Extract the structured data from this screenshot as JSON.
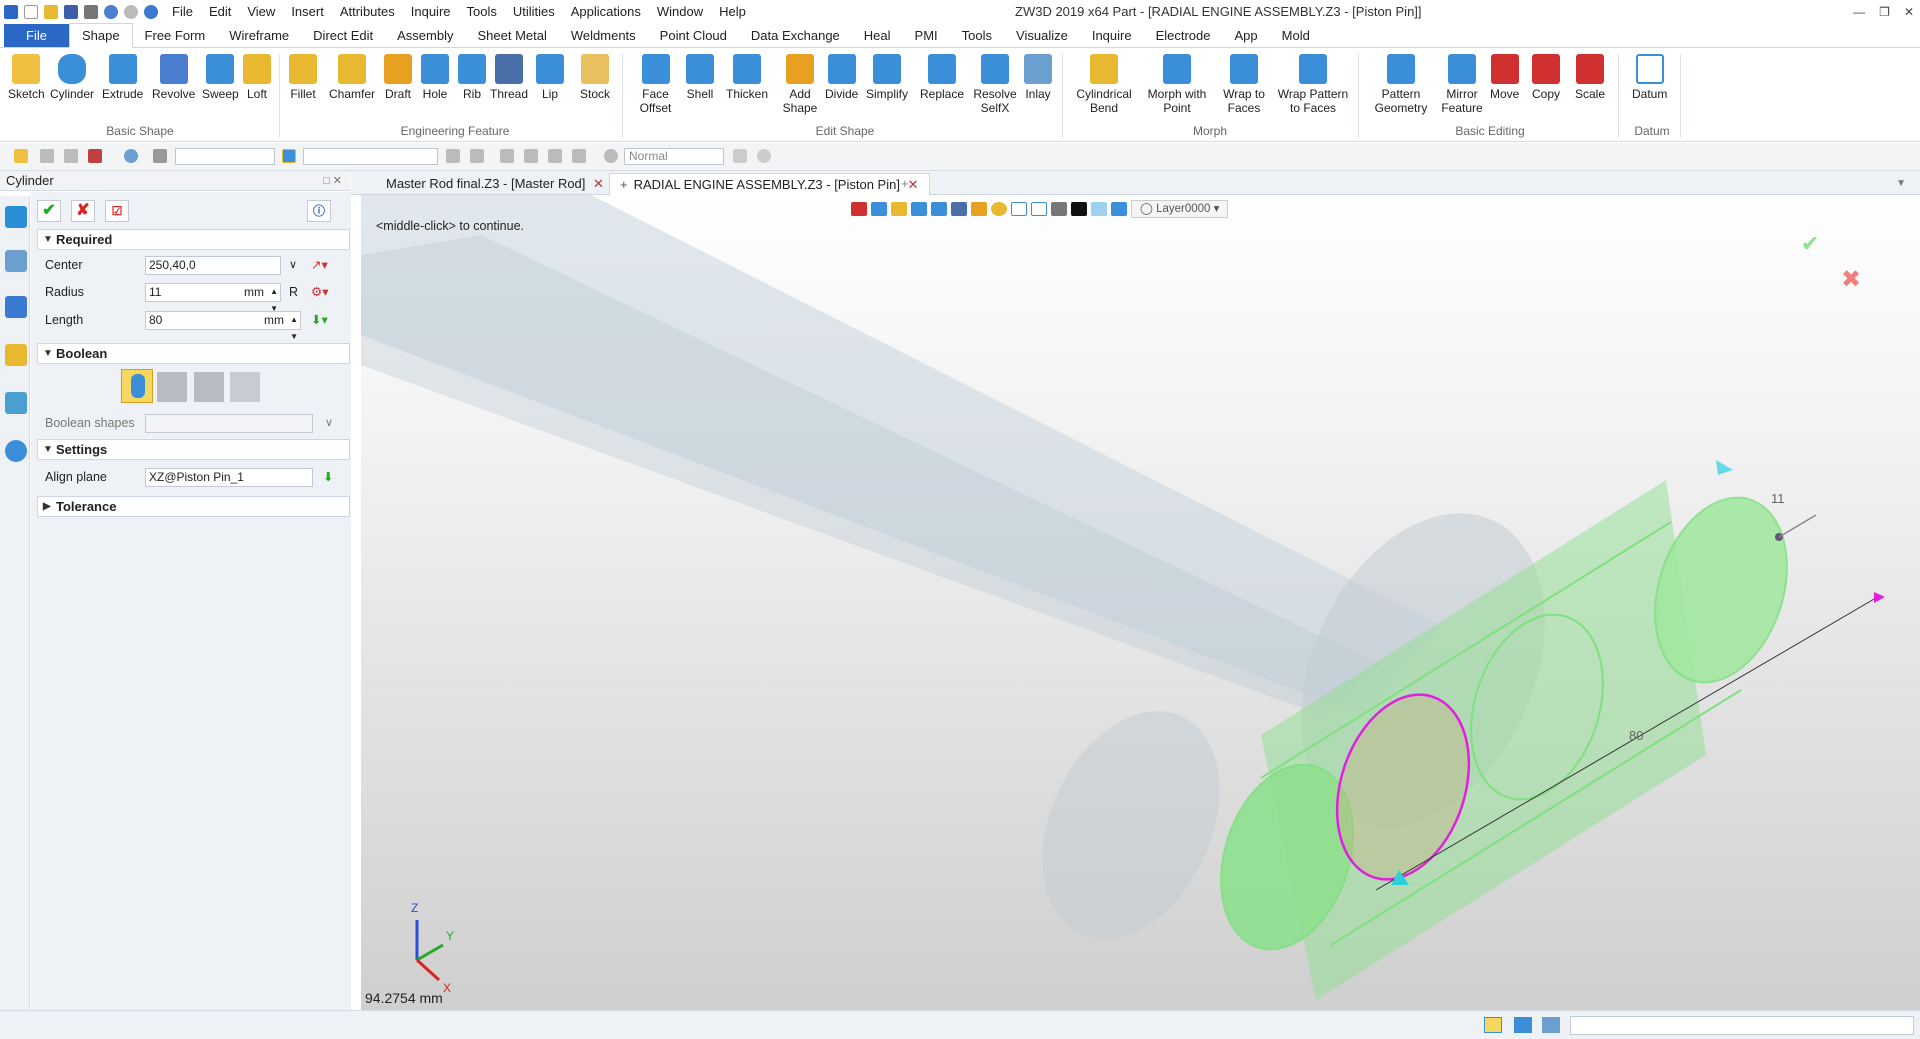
{
  "title_bar": {
    "menu": [
      "File",
      "Edit",
      "View",
      "Insert",
      "Attributes",
      "Inquire",
      "Tools",
      "Utilities",
      "Applications",
      "Window",
      "Help"
    ],
    "window_title": "ZW3D 2019  x64          Part - [RADIAL ENGINE ASSEMBLY.Z3 - [Piston Pin]]"
  },
  "ribbon_tabs": [
    "File",
    "Shape",
    "Free Form",
    "Wireframe",
    "Direct Edit",
    "Assembly",
    "Sheet Metal",
    "Weldments",
    "Point Cloud",
    "Data Exchange",
    "Heal",
    "PMI",
    "Tools",
    "Visualize",
    "Inquire",
    "Electrode",
    "App",
    "Mold"
  ],
  "ribbon": {
    "basic_shape": {
      "group_label": "Basic Shape",
      "buttons": [
        "Sketch",
        "Cylinder",
        "Extrude",
        "Revolve",
        "Sweep",
        "Loft"
      ]
    },
    "engineering_feature": {
      "group_label": "Engineering Feature",
      "buttons": [
        "Fillet",
        "Chamfer",
        "Draft",
        "Hole",
        "Rib",
        "Thread",
        "Lip",
        "Stock"
      ]
    },
    "edit_shape": {
      "group_label": "Edit Shape",
      "buttons": [
        "Face Offset",
        "Shell",
        "Thicken",
        "Add Shape",
        "Divide",
        "Simplify",
        "Replace",
        "Resolve SelfX",
        "Inlay"
      ]
    },
    "morph": {
      "group_label": "Morph",
      "buttons": [
        "Cylindrical Bend",
        "Morph with Point",
        "Wrap to Faces",
        "Wrap Pattern to Faces"
      ]
    },
    "basic_editing": {
      "group_label": "Basic Editing",
      "buttons": [
        "Pattern Geometry",
        "Mirror Feature",
        "Move",
        "Copy",
        "Scale"
      ]
    },
    "datum": {
      "group_label": "Datum",
      "buttons": [
        "Datum"
      ]
    }
  },
  "toolbar2": {
    "mode_combo": "Normal"
  },
  "panel": {
    "title": "Cylinder",
    "required": {
      "label": "Required",
      "center_label": "Center",
      "center_value": "250,40,0",
      "radius_label": "Radius",
      "radius_value": "11",
      "radius_unit": "mm",
      "radius_r": "R",
      "length_label": "Length",
      "length_value": "80",
      "length_unit": "mm"
    },
    "boolean": {
      "label": "Boolean",
      "shapes_label": "Boolean shapes"
    },
    "settings": {
      "label": "Settings",
      "align_plane_label": "Align plane",
      "align_plane_value": "XZ@Piston Pin_1"
    },
    "tolerance": {
      "label": "Tolerance"
    }
  },
  "doc_tabs": [
    "Master Rod final.Z3 - [Master Rod]",
    "RADIAL ENGINE ASSEMBLY.Z3 - [Piston Pin]"
  ],
  "viewport": {
    "prompt": "<middle-click> to continue.",
    "layer": "Layer0000",
    "dim_radius": "11",
    "dim_length": "80",
    "measure": "94.2754 mm",
    "axis_x": "X",
    "axis_y": "Y",
    "axis_z": "Z"
  },
  "colors": {
    "accent": "#2b67c4",
    "preview_green": "#7fe07f",
    "highlight_magenta": "#e020e0",
    "ok_green": "#22aa22",
    "cancel_red": "#dd2222"
  }
}
